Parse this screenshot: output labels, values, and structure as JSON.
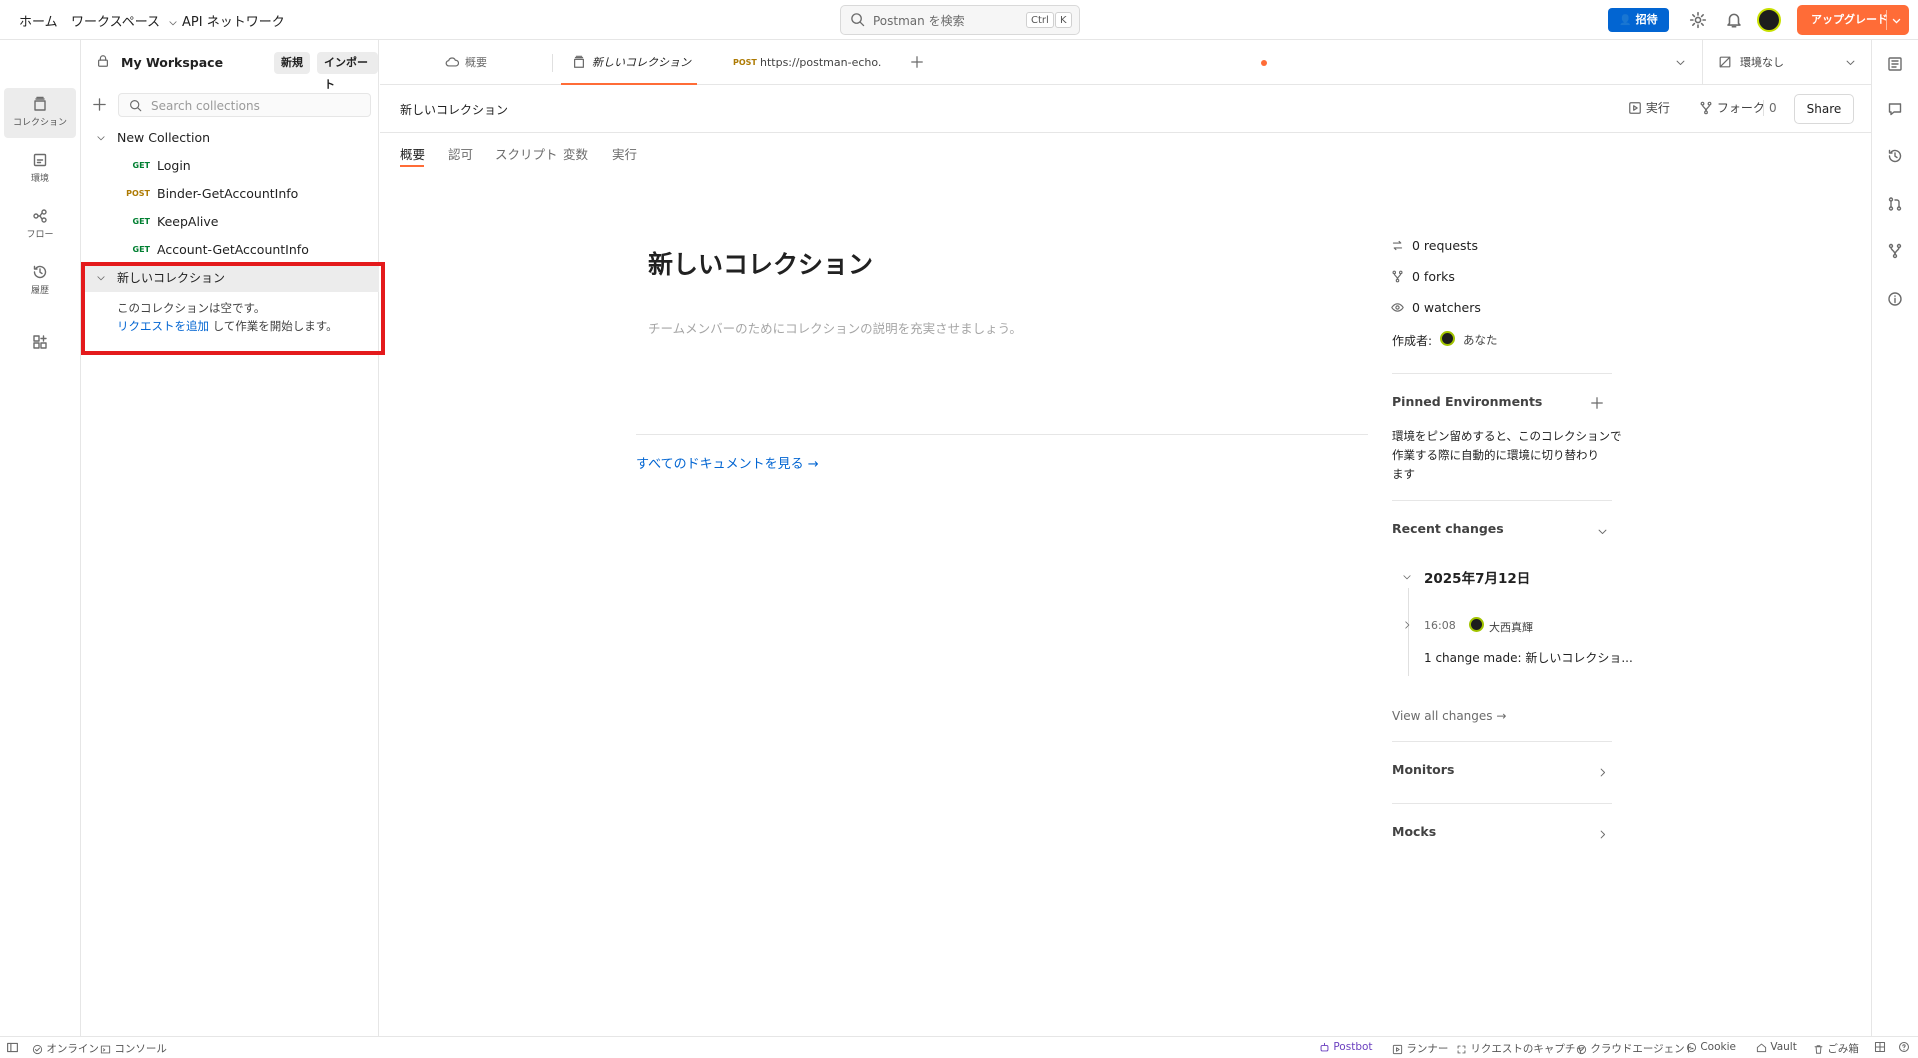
{
  "topbar": {
    "home": "ホーム",
    "workspaces": "ワークスペース",
    "api_network": "API ネットワーク",
    "search_placeholder": "Postman を検索",
    "kbd_ctrl": "Ctrl",
    "kbd_k": "K",
    "invite": "招待",
    "upgrade": "アップグレード"
  },
  "rail": {
    "items": [
      {
        "label": "コレクション",
        "icon": "collections-icon"
      },
      {
        "label": "環境",
        "icon": "environments-icon"
      },
      {
        "label": "フロー",
        "icon": "flows-icon"
      },
      {
        "label": "履歴",
        "icon": "history-icon"
      }
    ]
  },
  "sidebar": {
    "workspace": "My Workspace",
    "new_btn": "新規",
    "import_btn": "インポート",
    "search_placeholder": "Search collections",
    "collections": [
      {
        "name": "New Collection",
        "requests": [
          {
            "method": "GET",
            "name": "Login"
          },
          {
            "method": "POST",
            "name": "Binder-GetAccountInfo"
          },
          {
            "method": "GET",
            "name": "KeepAlive"
          },
          {
            "method": "GET",
            "name": "Account-GetAccountInfo"
          }
        ]
      },
      {
        "name": "新しいコレクション",
        "empty_text": "このコレクションは空です。",
        "add_request_link": "リクエストを追加",
        "empty_suffix": "して作業を開始します。"
      }
    ]
  },
  "tabs": {
    "overview": "概要",
    "collection": "新しいコレクション",
    "request_method": "POST",
    "request_url": "https://postman-echo.",
    "environment": "環境なし"
  },
  "main": {
    "breadcrumb_title": "新しいコレクション",
    "run": "実行",
    "fork": "フォーク",
    "fork_count": "0",
    "share": "Share",
    "subtabs": [
      "概要",
      "認可",
      "スクリプト",
      "変数",
      "実行"
    ],
    "title": "新しいコレクション",
    "description_placeholder": "チームメンバーのためにコレクションの説明を充実させましょう。",
    "view_docs": "すべてのドキュメントを見る →"
  },
  "right_panel": {
    "requests": "0 requests",
    "forks": "0 forks",
    "watchers": "0 watchers",
    "author_label": "作成者:",
    "author": "あなた",
    "pinned_title": "Pinned Environments",
    "pinned_text": [
      "環境をピン留めすると、このコレクションで",
      "作業する際に自動的に環境に切り替わり",
      "ます"
    ],
    "recent_title": "Recent changes",
    "date": "2025年7月12日",
    "time": "16:08",
    "user": "大西真輝",
    "change_text": "1 change made: 新しいコレクショ...",
    "view_all": "View all changes →",
    "monitors": "Monitors",
    "mocks": "Mocks"
  },
  "statusbar": {
    "online": "オンライン",
    "console": "コンソール",
    "postbot": "Postbot",
    "runner": "ランナー",
    "capture": "リクエストのキャプチャ",
    "cloud_agent": "クラウドエージェント",
    "cookie": "Cookie",
    "vault": "Vault",
    "trash": "ごみ箱"
  },
  "colors": {
    "accent": "#ff6c37",
    "primary_blue": "#0265d2",
    "link": "#0265d2",
    "highlight_box": "#e41a1c",
    "get": "#007f31",
    "post": "#ad7a03"
  }
}
